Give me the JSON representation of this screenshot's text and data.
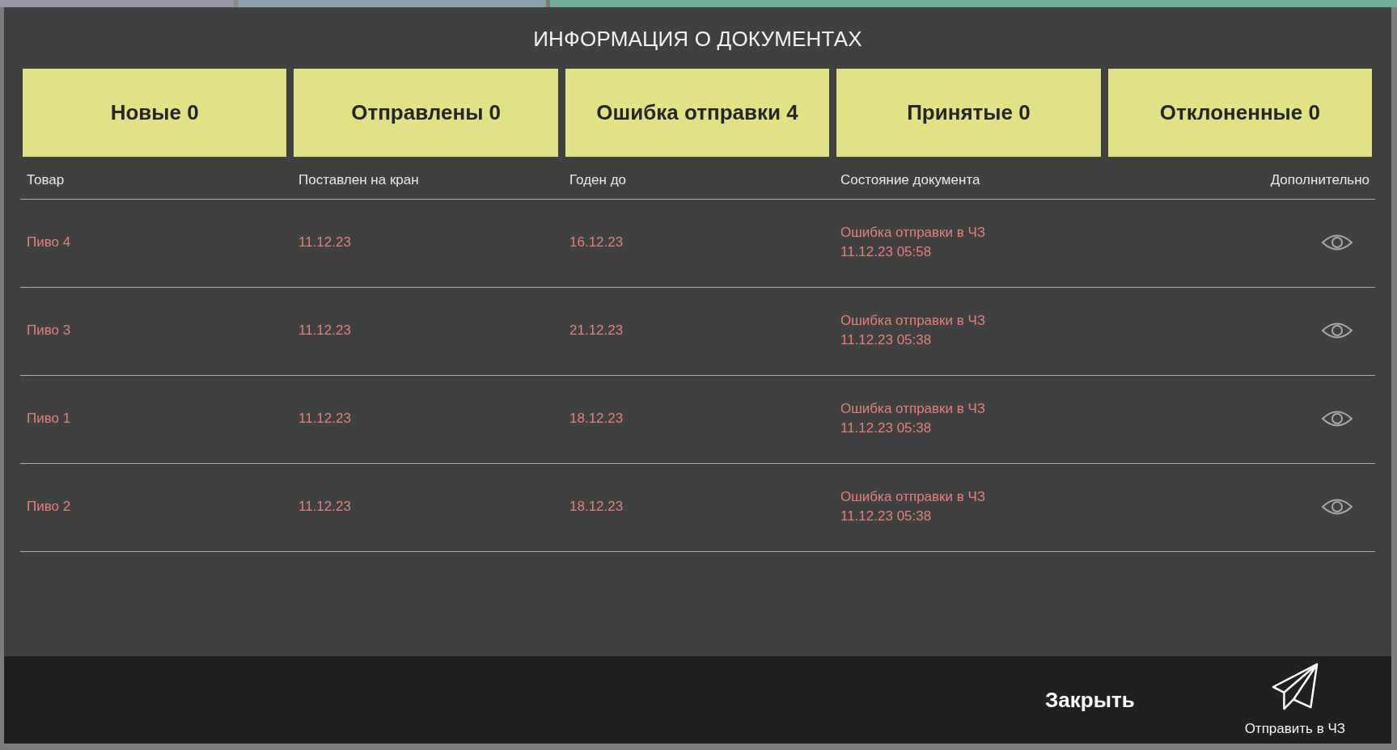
{
  "dialog": {
    "title": "ИНФОРМАЦИЯ О ДОКУМЕНТАХ"
  },
  "status_tiles": [
    {
      "label": "Новые",
      "count": "0"
    },
    {
      "label": "Отправлены",
      "count": "0"
    },
    {
      "label": "Ошибка отправки",
      "count": "4"
    },
    {
      "label": "Принятые",
      "count": "0"
    },
    {
      "label": "Отклоненные",
      "count": "0"
    }
  ],
  "table": {
    "columns": [
      "Товар",
      "Поставлен на кран",
      "Годен до",
      "Состояние документа",
      "Дополнительно"
    ],
    "rows": [
      {
        "product": "Пиво 4",
        "installed": "11.12.23",
        "expires": "16.12.23",
        "status": "Ошибка отправки в ЧЗ",
        "status_time": "11.12.23 05:58"
      },
      {
        "product": "Пиво 3",
        "installed": "11.12.23",
        "expires": "21.12.23",
        "status": "Ошибка отправки в ЧЗ",
        "status_time": "11.12.23 05:38"
      },
      {
        "product": "Пиво 1",
        "installed": "11.12.23",
        "expires": "18.12.23",
        "status": "Ошибка отправки в ЧЗ",
        "status_time": "11.12.23 05:38"
      },
      {
        "product": "Пиво 2",
        "installed": "11.12.23",
        "expires": "18.12.23",
        "status": "Ошибка отправки в ЧЗ",
        "status_time": "11.12.23 05:38"
      }
    ]
  },
  "footer": {
    "close_label": "Закрыть",
    "send_label": "Отправить в ЧЗ"
  }
}
